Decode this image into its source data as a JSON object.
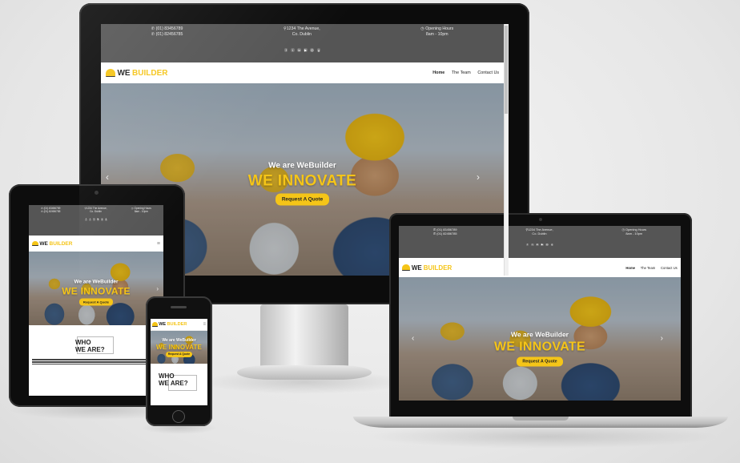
{
  "site": {
    "phone_1": "(01) 83456789",
    "phone_2": "(01) 82456785",
    "address_line_1": "1234 The Avenue,",
    "address_line_2": "Co. Dublin",
    "hours_label": "Opening Hours",
    "hours_value": "8am - 10pm",
    "logo_we": "WE",
    "logo_builder": "BUILDER",
    "nav": [
      "Home",
      "The Team",
      "Contact Us"
    ],
    "hero_subtitle": "We are WeBuilder",
    "hero_title": "WE INNOVATE",
    "hero_button": "Request A Quote",
    "about_title_1": "WHO",
    "about_title_2": "WE ARE?",
    "social_icons": [
      "facebook-icon",
      "twitter-icon",
      "linkedin-icon",
      "youtube-icon",
      "instagram-icon",
      "google-plus-icon"
    ]
  },
  "icons": {
    "phone": "✆",
    "pin": "⚲",
    "clock": "◷",
    "prev": "‹",
    "next": "›",
    "menu": "≡"
  },
  "colors": {
    "accent": "#f5c518",
    "topbar": "#555555",
    "device": "#0c0c0c"
  }
}
